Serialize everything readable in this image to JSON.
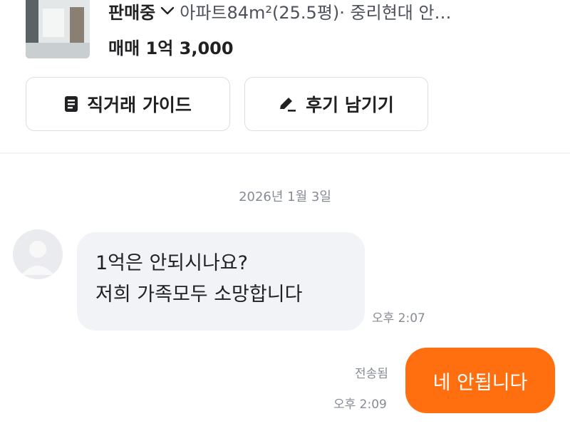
{
  "listing": {
    "status": "판매중",
    "title": "아파트84m²(25.5평)· 중리현대 안…",
    "price": "매매 1억 3,000"
  },
  "actions": {
    "guide_label": "직거래 가이드",
    "review_label": "후기 남기기"
  },
  "chat": {
    "date": "2026년 1월 3일",
    "incoming": {
      "line1": "1억은 안되시나요?",
      "line2": "저희 가족모두 소망합니다",
      "time": "오후 2:07"
    },
    "outgoing": {
      "text": "네 안됩니다",
      "status": "전송됨",
      "time": "오후 2:09"
    }
  },
  "colors": {
    "accent": "#ff6f0f",
    "bubble_in": "#f2f3f6",
    "meta_text": "#868b94"
  }
}
